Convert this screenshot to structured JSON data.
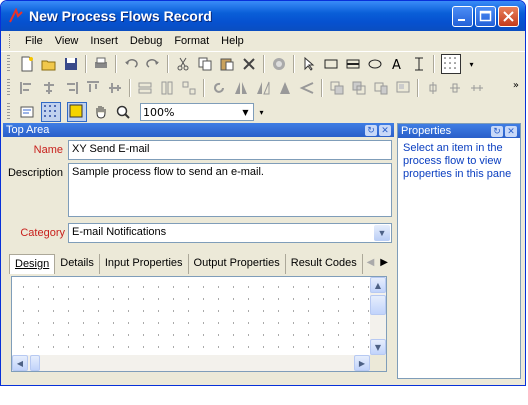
{
  "window": {
    "title": "New Process Flows Record"
  },
  "menu": {
    "items": [
      "File",
      "View",
      "Insert",
      "Debug",
      "Format",
      "Help"
    ]
  },
  "toolbar": {
    "zoom": "100%"
  },
  "top_area": {
    "title": "Top Area",
    "name_label": "Name",
    "name_value": "XY Send E-mail",
    "description_label": "Description",
    "description_value": "Sample process flow to send an e-mail.",
    "category_label": "Category",
    "category_value": "E-mail Notifications"
  },
  "tabs": [
    "Design",
    "Details",
    "Input Properties",
    "Output Properties",
    "Result Codes"
  ],
  "properties": {
    "title": "Properties",
    "hint": "Select an item in the process flow to view properties in this pane"
  },
  "colors": {
    "title_bar": "#0a5fd8",
    "label_required": "#c8201c",
    "hint_text": "#0a3ec0"
  }
}
